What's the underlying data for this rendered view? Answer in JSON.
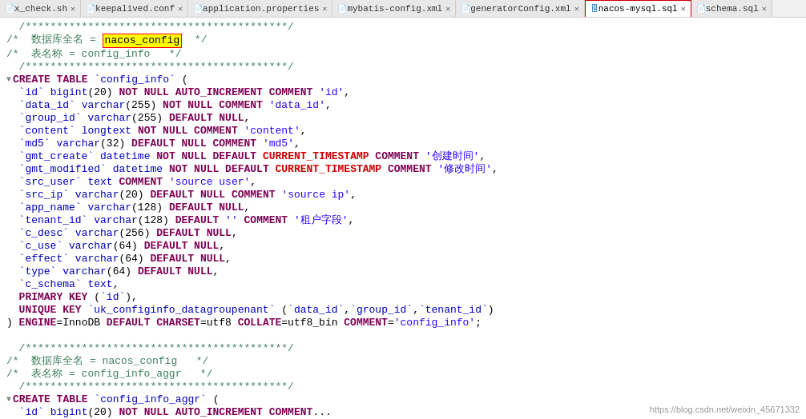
{
  "tabs": [
    {
      "label": "x_check.sh",
      "icon": "📄",
      "active": false,
      "id": "tab1"
    },
    {
      "label": "keepalived.conf",
      "icon": "📄",
      "active": false,
      "id": "tab2"
    },
    {
      "label": "application.properties",
      "icon": "📄",
      "active": false,
      "id": "tab3"
    },
    {
      "label": "mybatis-config.xml",
      "icon": "📄",
      "active": false,
      "id": "tab4"
    },
    {
      "label": "generatorConfig.xml",
      "icon": "📄",
      "active": false,
      "id": "tab5"
    },
    {
      "label": "nacos-mysql.sql",
      "icon": "🗄",
      "active": true,
      "id": "tab6"
    },
    {
      "label": "schema.sql",
      "icon": "📄",
      "active": false,
      "id": "tab7"
    }
  ],
  "watermark": "https://blog.csdn.net/weixin_45671332",
  "code": {
    "lines": []
  }
}
